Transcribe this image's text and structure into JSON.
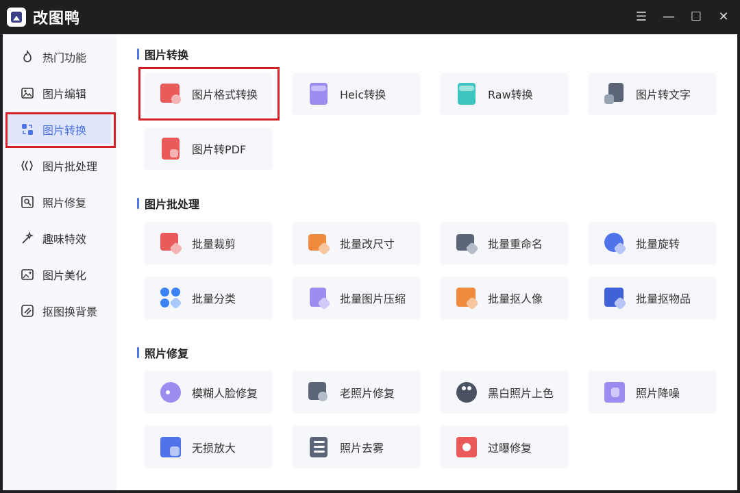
{
  "app": {
    "title": "改图鸭"
  },
  "window_controls": {
    "menu": "☰",
    "minimize": "—",
    "maximize": "☐",
    "close": "✕"
  },
  "sidebar": {
    "items": [
      {
        "label": "热门功能",
        "icon": "fire-icon"
      },
      {
        "label": "图片编辑",
        "icon": "image-edit-icon"
      },
      {
        "label": "图片转换",
        "icon": "convert-icon",
        "active": true
      },
      {
        "label": "图片批处理",
        "icon": "batch-icon"
      },
      {
        "label": "照片修复",
        "icon": "photo-repair-icon"
      },
      {
        "label": "趣味特效",
        "icon": "magic-wand-icon"
      },
      {
        "label": "图片美化",
        "icon": "beautify-icon"
      },
      {
        "label": "抠图换背景",
        "icon": "cutout-icon"
      }
    ]
  },
  "sections": [
    {
      "title": "图片转换",
      "items": [
        {
          "label": "图片格式转换",
          "icon": "image-format-icon"
        },
        {
          "label": "Heic转换",
          "icon": "heic-icon"
        },
        {
          "label": "Raw转换",
          "icon": "raw-icon"
        },
        {
          "label": "图片转文字",
          "icon": "image-to-text-icon"
        },
        {
          "label": "图片转PDF",
          "icon": "image-to-pdf-icon"
        }
      ]
    },
    {
      "title": "图片批处理",
      "items": [
        {
          "label": "批量裁剪",
          "icon": "batch-crop-icon"
        },
        {
          "label": "批量改尺寸",
          "icon": "batch-resize-icon"
        },
        {
          "label": "批量重命名",
          "icon": "batch-rename-icon"
        },
        {
          "label": "批量旋转",
          "icon": "batch-rotate-icon"
        },
        {
          "label": "批量分类",
          "icon": "batch-classify-icon"
        },
        {
          "label": "批量图片压缩",
          "icon": "batch-compress-icon"
        },
        {
          "label": "批量抠人像",
          "icon": "batch-portrait-cutout-icon"
        },
        {
          "label": "批量抠物品",
          "icon": "batch-object-cutout-icon"
        }
      ]
    },
    {
      "title": "照片修复",
      "items": [
        {
          "label": "模糊人脸修复",
          "icon": "face-repair-icon"
        },
        {
          "label": "老照片修复",
          "icon": "old-photo-repair-icon"
        },
        {
          "label": "黑白照片上色",
          "icon": "colorize-icon"
        },
        {
          "label": "照片降噪",
          "icon": "denoise-icon"
        },
        {
          "label": "无损放大",
          "icon": "upscale-icon"
        },
        {
          "label": "照片去雾",
          "icon": "dehaze-icon"
        },
        {
          "label": "过曝修复",
          "icon": "overexposure-repair-icon"
        }
      ]
    }
  ],
  "colors": {
    "accent": "#4f73e8",
    "highlight": "#d21f28",
    "titlebar": "#1f1f21"
  }
}
